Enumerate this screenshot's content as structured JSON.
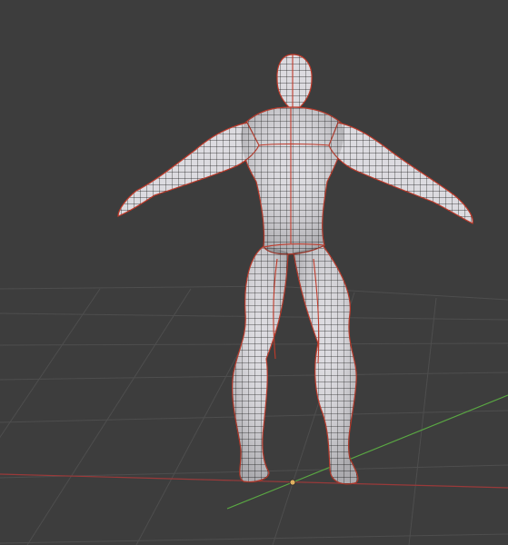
{
  "viewport": {
    "background": "#3d3d3d",
    "grid_color": "#4e4e4e",
    "x_axis_color": "#9a3a3a",
    "y_axis_color": "#5aa843",
    "origin_color": "#e0b060",
    "mesh_fill": "#dcdbe0",
    "wire_color": "#1a1a1a",
    "seam_color": "#c03a2a",
    "view": "back",
    "grid": true
  }
}
